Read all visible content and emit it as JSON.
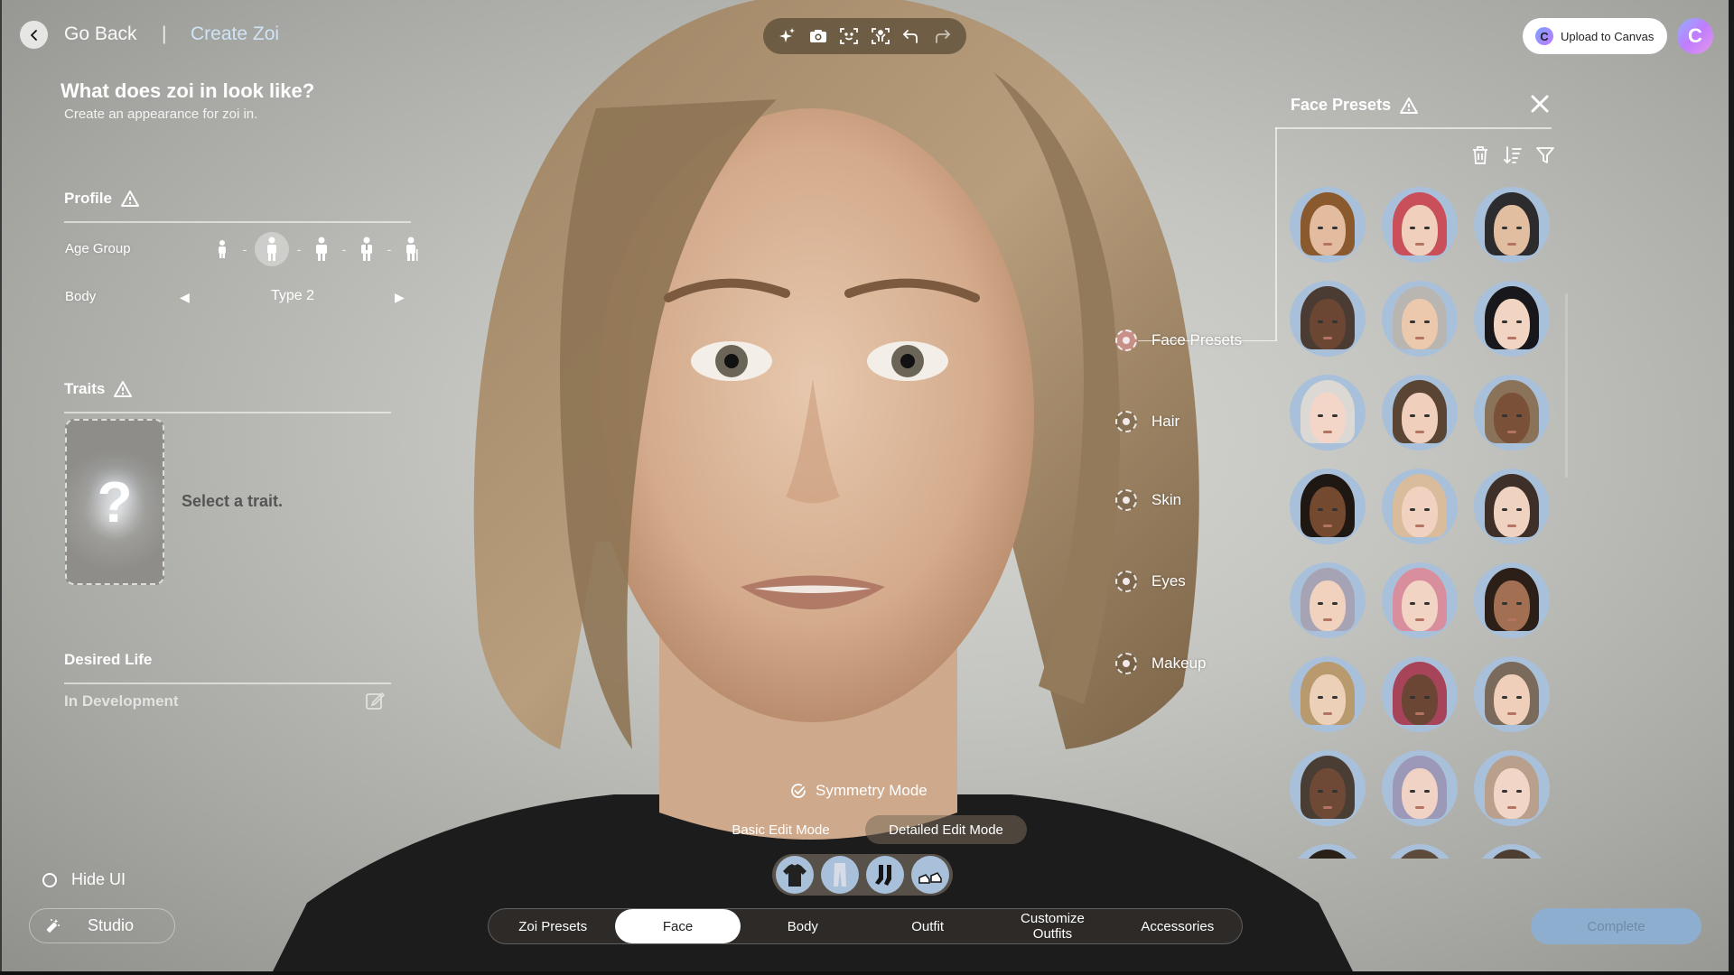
{
  "nav": {
    "back_label": "Go Back",
    "separator": "|",
    "current": "Create Zoi"
  },
  "header": {
    "title": "What does zoi in look like?",
    "subtitle": "Create an appearance for zoi in."
  },
  "profile": {
    "title": "Profile",
    "age_group_label": "Age Group",
    "age_groups": [
      "child",
      "teen",
      "young-adult",
      "adult",
      "elder"
    ],
    "selected_age_group": "teen",
    "body_label": "Body",
    "body_value": "Type 2"
  },
  "traits": {
    "title": "Traits",
    "placeholder": "?",
    "prompt": "Select a trait."
  },
  "desired_life": {
    "title": "Desired Life",
    "status": "In Development"
  },
  "bottom_left": {
    "hide_ui": "Hide UI",
    "studio": "Studio"
  },
  "toolbar": {
    "tools": [
      "sparkle-icon",
      "camera-icon",
      "face-scan-icon",
      "body-scan-icon",
      "undo-icon",
      "redo-icon"
    ]
  },
  "top_right": {
    "upload_label": "Upload to Canvas",
    "logo_letter": "C"
  },
  "face_presets": {
    "title": "Face Presets",
    "actions": [
      "trash-icon",
      "sort-icon",
      "filter-icon"
    ],
    "presets": [
      {
        "hair": "#8a5a2e",
        "skin": "#e3bca0"
      },
      {
        "hair": "#c9505a",
        "skin": "#f0d0bc"
      },
      {
        "hair": "#2c2c2e",
        "skin": "#e2bea0"
      },
      {
        "hair": "#4a3c32",
        "skin": "#6b4633"
      },
      {
        "hair": "#b9b6b2",
        "skin": "#ecc9ad"
      },
      {
        "hair": "#18181c",
        "skin": "#f1d4c2"
      },
      {
        "hair": "#dcd8d4",
        "skin": "#f3d6c8"
      },
      {
        "hair": "#5a4434",
        "skin": "#f0d0bc"
      },
      {
        "hair": "#8a7358",
        "skin": "#7a5038"
      },
      {
        "hair": "#1f1712",
        "skin": "#73492f"
      },
      {
        "hair": "#d8bc9c",
        "skin": "#f1d2c0"
      },
      {
        "hair": "#3e3028",
        "skin": "#efd2bf"
      },
      {
        "hair": "#a6a4b4",
        "skin": "#f0d2bf"
      },
      {
        "hair": "#d88e9c",
        "skin": "#f2d4c4"
      },
      {
        "hair": "#2b1f18",
        "skin": "#a26f52"
      },
      {
        "hair": "#b89a6e",
        "skin": "#ecd0b8"
      },
      {
        "hair": "#a8445a",
        "skin": "#6b4634"
      },
      {
        "hair": "#7a6a5c",
        "skin": "#f0cfba"
      },
      {
        "hair": "#4a3e34",
        "skin": "#6e4a36"
      },
      {
        "hair": "#9c98b8",
        "skin": "#f0d3c4"
      },
      {
        "hair": "#b8a08c",
        "skin": "#f1d6c8"
      },
      {
        "hair": "#2a2018",
        "skin": "#6e4a36"
      },
      {
        "hair": "#5c4a3a",
        "skin": "#e8c6ad"
      },
      {
        "hair": "#4e3e32",
        "skin": "#e8c6ad"
      }
    ]
  },
  "hotspots": [
    {
      "label": "Face Presets",
      "active": true
    },
    {
      "label": "Hair",
      "active": false
    },
    {
      "label": "Skin",
      "active": false
    },
    {
      "label": "Eyes",
      "active": false
    },
    {
      "label": "Makeup",
      "active": false
    }
  ],
  "edit": {
    "symmetry_label": "Symmetry Mode",
    "basic_mode": "Basic Edit Mode",
    "detailed_mode": "Detailed Edit Mode",
    "selected_mode": "Detailed Edit Mode"
  },
  "outfit_thumbs": [
    "t-shirt",
    "jeans",
    "socks",
    "sneakers"
  ],
  "tabs": [
    {
      "label": "Zoi Presets",
      "active": false
    },
    {
      "label": "Face",
      "active": true
    },
    {
      "label": "Body",
      "active": false
    },
    {
      "label": "Outfit",
      "active": false
    },
    {
      "label": "Customize\nOutfits",
      "active": false
    },
    {
      "label": "Accessories",
      "active": false
    }
  ],
  "complete_label": "Complete",
  "colors": {
    "accent_blue": "#cfe3f6",
    "complete_bg": "#8eaed0",
    "preset_bg": "#a9c0db"
  }
}
